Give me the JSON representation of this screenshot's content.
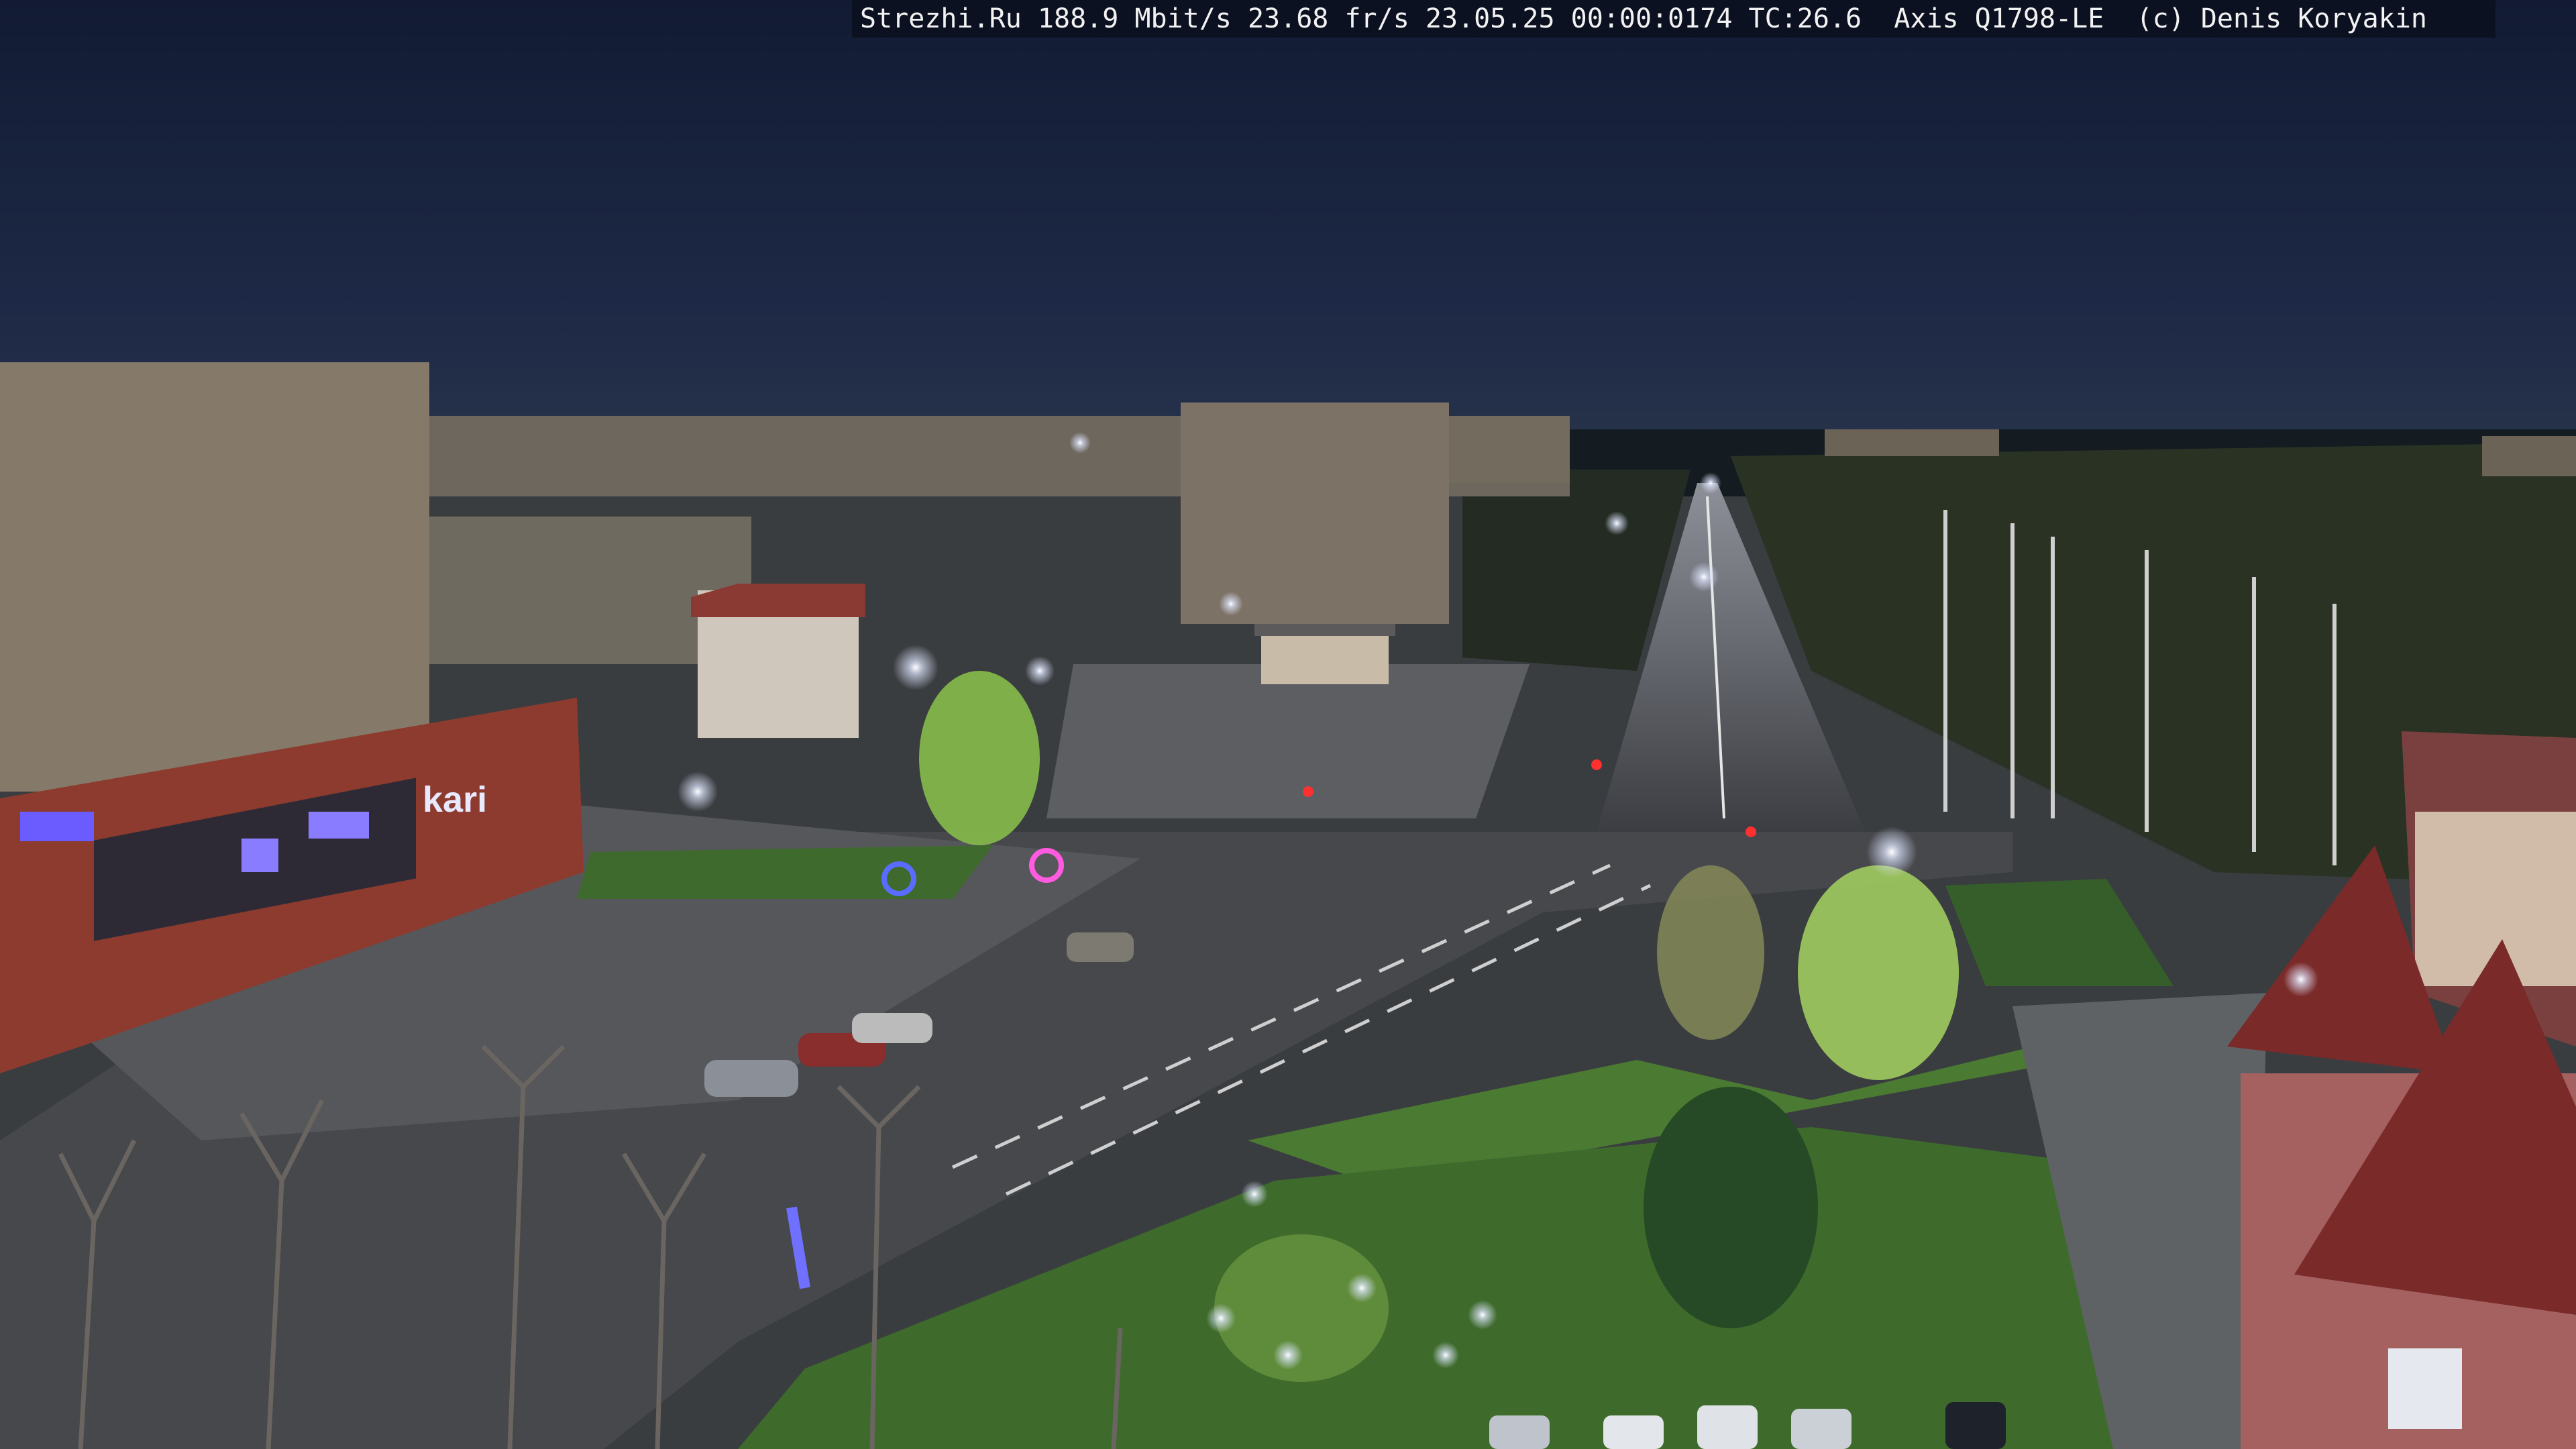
{
  "camera_overlay": {
    "text": "Strezhi.Ru 188.9 Mbit/s 23.68 fr/s 23.05.25 00:00:0174 TC:26.6  Axis Q1798-LE  (c) Denis Koryakin"
  },
  "signs": {
    "store_sign": "kari"
  },
  "colors": {
    "sky": "#1a2540",
    "road": "#4a4c52",
    "grass": "#3b6a2c",
    "building_brick": "#8c3b2e",
    "panel_building": "#8a8070",
    "streetlight": "#f4f6ff",
    "shop_sign": "#6a5cff"
  }
}
